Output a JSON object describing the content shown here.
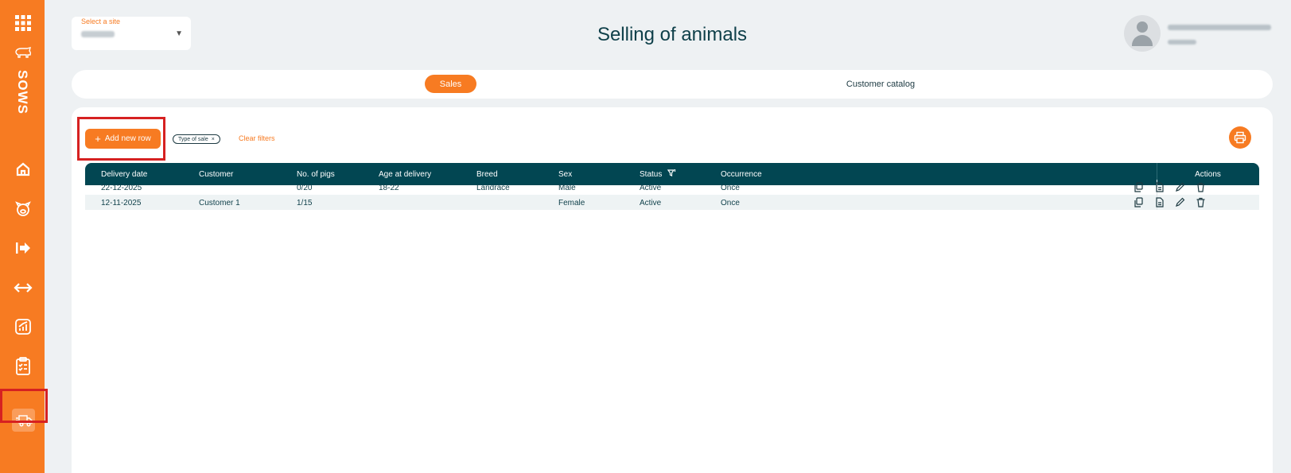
{
  "sidebar": {
    "brand": "SOWS",
    "items": [
      "apps-grid-icon",
      "pig-logo-icon",
      "home-icon",
      "pig-face-icon",
      "exit-arrow-icon",
      "transfer-arrows-icon",
      "chart-icon",
      "clipboard-checklist-icon",
      "truck-icon"
    ],
    "active_item": "truck-icon"
  },
  "header": {
    "site_select_label": "Select a site",
    "title": "Selling of animals"
  },
  "tabs": [
    {
      "label": "Sales",
      "active": true
    },
    {
      "label": "Customer catalog",
      "active": false
    }
  ],
  "toolbar": {
    "add_label": "Add new row",
    "filter_chip": "Type of sale",
    "filter_chip_remove": "×",
    "clear_label": "Clear filters"
  },
  "table": {
    "columns": [
      "Delivery date",
      "Customer",
      "No. of pigs",
      "Age at delivery",
      "Breed",
      "Sex",
      "Status",
      "Occurrence"
    ],
    "actions_header": "Actions",
    "rows": [
      {
        "date": "22-12-2025",
        "customer": "",
        "pigs": "0/20",
        "age": "18-22",
        "breed": "Landrace",
        "sex": "Male",
        "status": "Active",
        "occurrence": "Once"
      },
      {
        "date": "12-11-2025",
        "customer": "Customer 1",
        "pigs": "1/15",
        "age": "",
        "breed": "",
        "sex": "Female",
        "status": "Active",
        "occurrence": "Once"
      }
    ]
  },
  "colors": {
    "accent": "#f77b22",
    "header_dark": "#024652",
    "highlight": "#d62121"
  }
}
